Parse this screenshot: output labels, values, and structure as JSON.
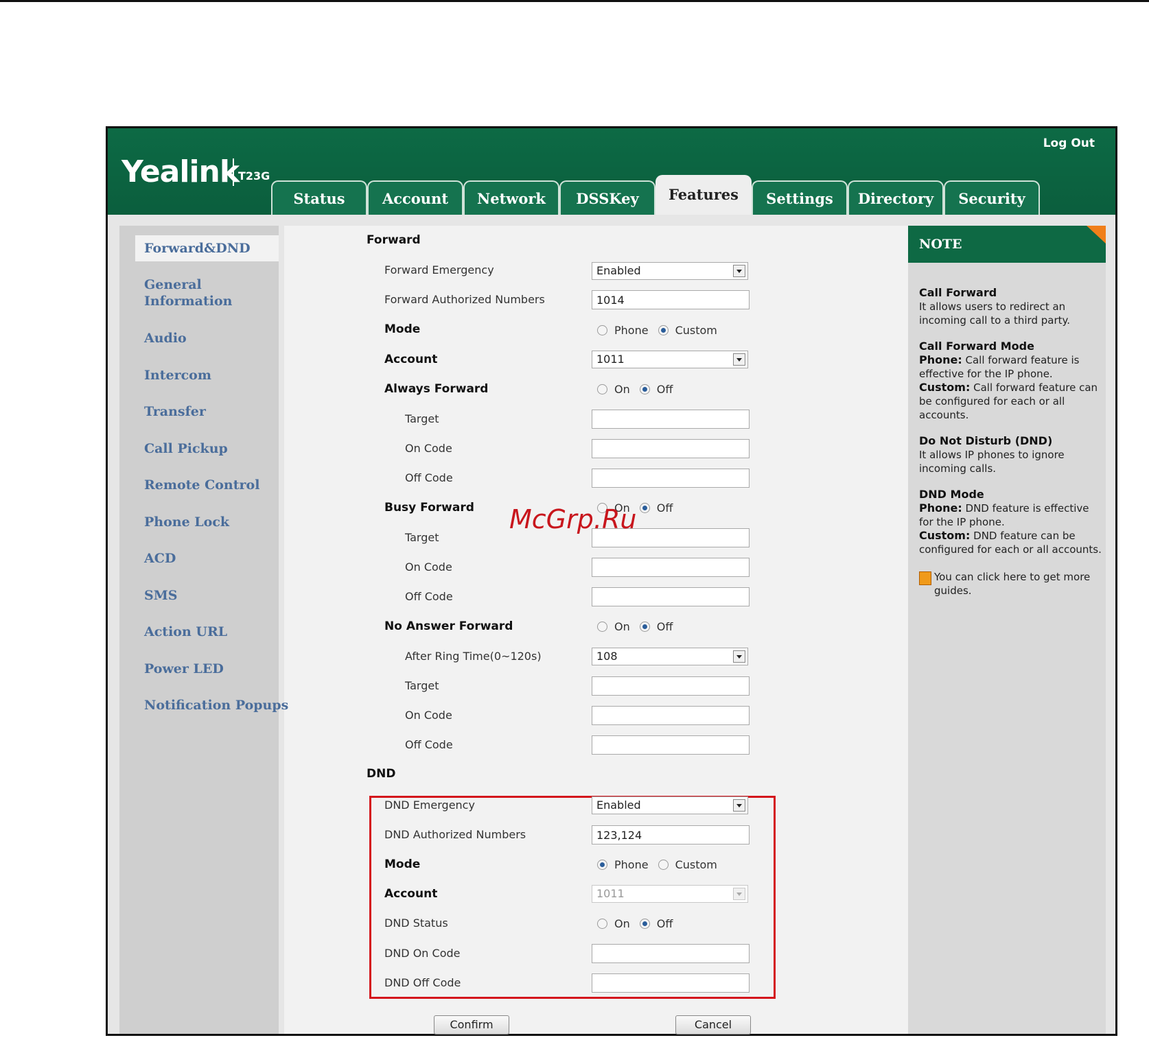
{
  "header": {
    "logo": "Yealink",
    "model": "T23G",
    "logout": "Log Out",
    "tabs": [
      "Status",
      "Account",
      "Network",
      "DSSKey",
      "Features",
      "Settings",
      "Directory",
      "Security"
    ],
    "active_tab": "Features"
  },
  "sidebar": {
    "items": [
      "Forward&DND",
      "General Information",
      "Audio",
      "Intercom",
      "Transfer",
      "Call Pickup",
      "Remote Control",
      "Phone Lock",
      "ACD",
      "SMS",
      "Action URL",
      "Power LED",
      "Notification Popups"
    ],
    "active": "Forward&DND"
  },
  "forward": {
    "title": "Forward",
    "emergency_label": "Forward Emergency",
    "emergency_value": "Enabled",
    "authorized_label": "Forward Authorized Numbers",
    "authorized_value": "1014",
    "mode_label": "Mode",
    "mode_phone": "Phone",
    "mode_custom": "Custom",
    "mode_selected": "Custom",
    "account_label": "Account",
    "account_value": "1011",
    "always_label": "Always Forward",
    "busy_label": "Busy Forward",
    "noanswer_label": "No Answer Forward",
    "on": "On",
    "off": "Off",
    "target_label": "Target",
    "on_code_label": "On Code",
    "off_code_label": "Off Code",
    "ring_time_label": "After Ring Time(0~120s)",
    "ring_time_value": "108"
  },
  "dnd": {
    "title": "DND",
    "emergency_label": "DND Emergency",
    "emergency_value": "Enabled",
    "authorized_label": "DND Authorized Numbers",
    "authorized_value": "123,124",
    "mode_label": "Mode",
    "mode_phone": "Phone",
    "mode_custom": "Custom",
    "mode_selected": "Phone",
    "account_label": "Account",
    "account_value": "1011",
    "status_label": "DND Status",
    "on": "On",
    "off": "Off",
    "on_code_label": "DND On Code",
    "off_code_label": "DND Off Code"
  },
  "buttons": {
    "confirm": "Confirm",
    "cancel": "Cancel"
  },
  "note": {
    "title": "NOTE",
    "call_forward_title": "Call Forward",
    "call_forward_text": "It allows users to redirect an incoming call to a third party.",
    "cf_mode_title": "Call Forward Mode",
    "cf_phone_key": "Phone:",
    "cf_phone_text": " Call forward feature is effective for the IP phone.",
    "cf_custom_key": "Custom:",
    "cf_custom_text": " Call forward feature can be configured for each or all accounts.",
    "dnd_title": "Do Not Disturb (DND)",
    "dnd_text": "It allows IP phones to ignore incoming calls.",
    "dnd_mode_title": "DND Mode",
    "dnd_phone_key": "Phone:",
    "dnd_phone_text": " DND feature is effective for the IP phone.",
    "dnd_custom_key": "Custom:",
    "dnd_custom_text": " DND feature can be configured for each or all accounts.",
    "guide_text": "You can click here to get more guides."
  },
  "watermark": "McGrp.Ru",
  "colors": {
    "header_green": "#0b5e3d",
    "nav_blue": "#4a6d9b",
    "highlight_red": "#d4151c",
    "note_corner": "#f07f1a"
  }
}
